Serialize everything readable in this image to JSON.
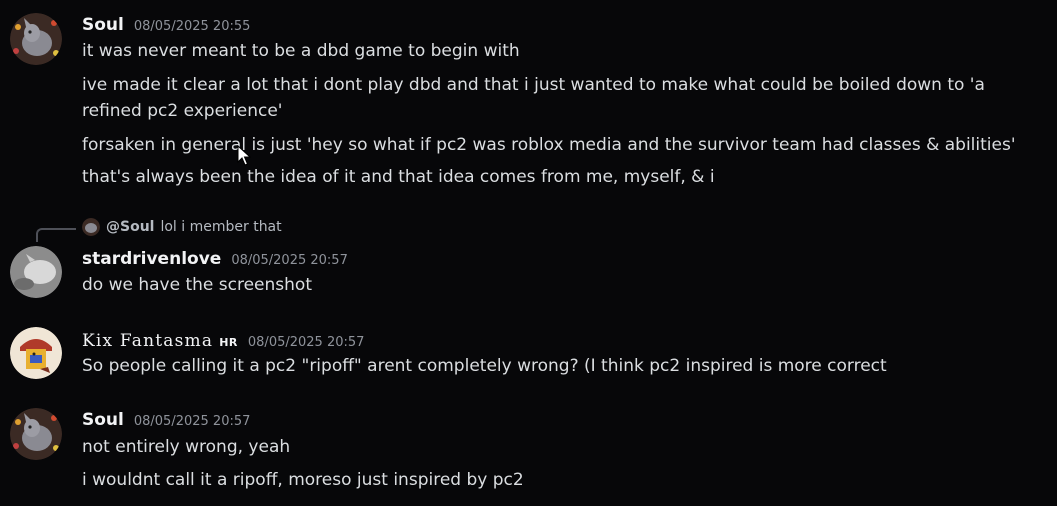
{
  "messages": [
    {
      "author": "Soul",
      "timestamp": "08/05/2025 20:55",
      "lines": [
        "it was never meant to be a dbd game to begin with",
        "ive made it clear a lot that i dont play dbd and that i just wanted to make what could be boiled down to 'a refined pc2 experience'",
        "forsaken in general is just 'hey so what if pc2 was roblox media and the survivor team had classes & abilities'",
        "that's always been the idea of it and that idea comes from me, myself, & i"
      ]
    },
    {
      "reply_to": {
        "mention": "@Soul",
        "text": "lol i member that"
      },
      "author": "stardrivenlove",
      "timestamp": "08/05/2025 20:57",
      "lines": [
        "do we have the screenshot"
      ]
    },
    {
      "author": "Kix Fantasma",
      "role_tag": "HR",
      "timestamp": "08/05/2025 20:57",
      "lines": [
        "So people calling it a pc2 \"ripoff\" arent completely wrong? (I think pc2 inspired is more correct"
      ]
    },
    {
      "author": "Soul",
      "timestamp": "08/05/2025 20:57",
      "lines": [
        "not entirely wrong, yeah",
        "i wouldnt call it a ripoff, moreso just inspired by pc2"
      ]
    }
  ],
  "colors": {
    "background": "#070709",
    "text": "#dbdee1",
    "username": "#f2f3f5",
    "timestamp": "#8f939b",
    "reply_text": "#b5bac1"
  }
}
